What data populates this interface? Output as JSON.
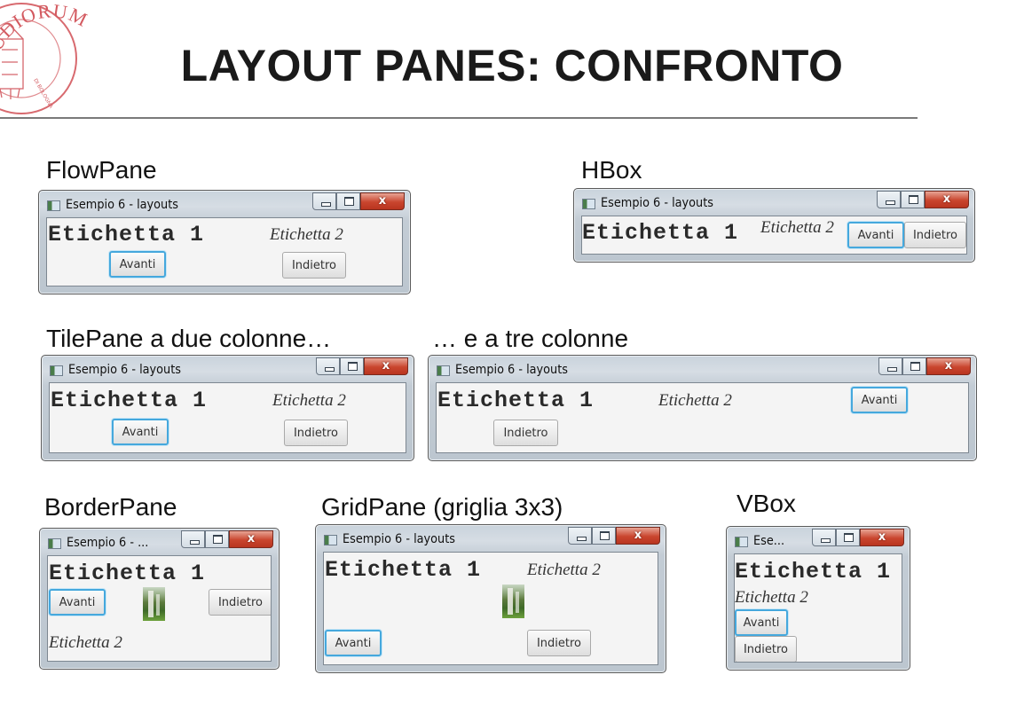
{
  "title": "LAYOUT PANES: CONFRONTO",
  "logo": {
    "text_top": "STUDIORUM",
    "text_inner": "DI BOLOGNA"
  },
  "window_title": "Esempio 6 - layouts",
  "colors": {
    "focus": "#45a8dd",
    "close_button": "#c9452e",
    "logo": "#c8404a"
  },
  "controls": {
    "minimize_icon": "minimize-icon",
    "maximize_icon": "maximize-icon",
    "close_glyph": "x"
  },
  "panes": {
    "flowpane": {
      "label": "FlowPane",
      "window_title": "Esempio 6 - layouts",
      "label1": "Etichetta 1",
      "label2": "Etichetta 2",
      "next": "Avanti",
      "back": "Indietro"
    },
    "hbox": {
      "label": "HBox",
      "window_title": "Esempio 6 - layouts",
      "label1": "Etichetta 1",
      "label2": "Etichetta 2",
      "next": "Avanti",
      "back": "Indietro"
    },
    "tile2": {
      "label": "TilePane a due colonne…",
      "window_title": "Esempio 6 - layouts",
      "label1": "Etichetta 1",
      "label2": "Etichetta 2",
      "next": "Avanti",
      "back": "Indietro"
    },
    "tile3": {
      "label": "… e a tre colonne",
      "window_title": "Esempio 6 - layouts",
      "label1": "Etichetta 1",
      "label2": "Etichetta 2",
      "next": "Avanti",
      "back": "Indietro"
    },
    "borderpane": {
      "label": "BorderPane",
      "window_title": "Esempio 6 - ...",
      "label1": "Etichetta 1",
      "label2": "Etichetta 2",
      "next": "Avanti",
      "back": "Indietro"
    },
    "gridpane": {
      "label": "GridPane (griglia 3x3)",
      "window_title": "Esempio 6 - layouts",
      "label1": "Etichetta 1",
      "label2": "Etichetta 2",
      "next": "Avanti",
      "back": "Indietro"
    },
    "vbox": {
      "label": "VBox",
      "window_title": "Ese...",
      "label1": "Etichetta 1",
      "label2": "Etichetta 2",
      "next": "Avanti",
      "back": "Indietro"
    }
  }
}
